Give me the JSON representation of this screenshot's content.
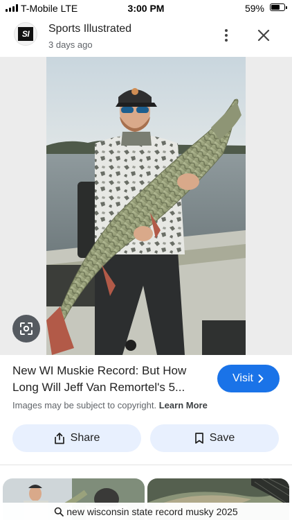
{
  "status_bar": {
    "carrier": "T-Mobile  LTE",
    "time": "3:00 PM",
    "battery_percent": "59%",
    "battery_level": 0.59
  },
  "source": {
    "name": "Sports Illustrated",
    "logo_text": "SI",
    "date": "3 days ago"
  },
  "result": {
    "title": "New WI Muskie Record: But How Long Will Jeff Van Remortel's 5...",
    "visit_label": "Visit",
    "copyright_text": "Images may be subject to copyright.",
    "learn_more": "Learn More"
  },
  "actions": {
    "share_label": "Share",
    "save_label": "Save"
  },
  "search": {
    "query": "new wisconsin state record musky 2025"
  },
  "colors": {
    "accent": "#1a73e8",
    "button_tint": "#e8f0fe",
    "muted_text": "#5f6368"
  },
  "icons": [
    "signal-icon",
    "battery-icon",
    "more-vert-icon",
    "close-icon",
    "lens-icon",
    "chevron-right-icon",
    "share-icon",
    "bookmark-icon",
    "search-icon"
  ]
}
